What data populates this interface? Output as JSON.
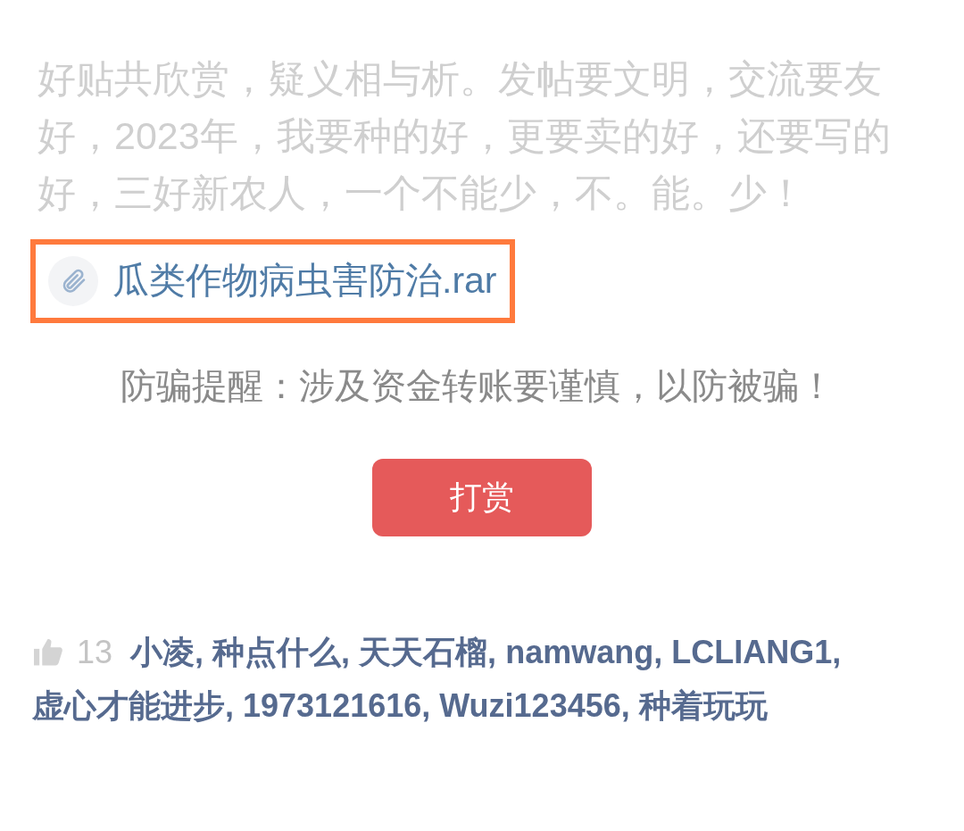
{
  "post": {
    "body": "好贴共欣赏，疑义相与析。发帖要文明，交流要友好，2023年，我要种的好，更要卖的好，还要写的好，三好新农人，一个不能少，不。能。少！"
  },
  "attachment": {
    "filename": "瓜类作物病虫害防治.rar",
    "highlighted": true
  },
  "warning": "防骗提醒：涉及资金转账要谨慎，以防被骗！",
  "reward_button": "打赏",
  "likes": {
    "count": "13",
    "likers": [
      "小凌,",
      "种点什么,",
      "天天石榴,",
      "namwang,",
      "LCLIANG1,",
      "虚心才能进步,",
      "1973121616,",
      "Wuzi123456,",
      "种着玩玩"
    ]
  }
}
